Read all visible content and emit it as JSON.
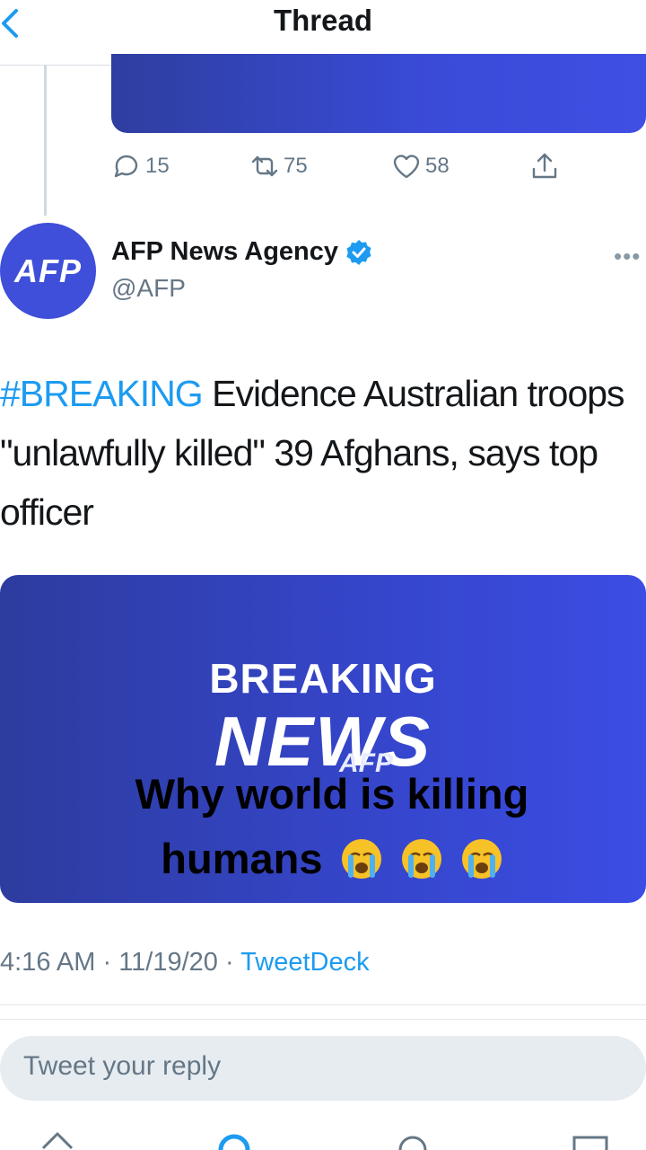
{
  "header": {
    "title": "Thread"
  },
  "prev_tweet": {
    "replies": "15",
    "retweets": "75",
    "likes": "58"
  },
  "tweet": {
    "author_name": "AFP News Agency",
    "handle": "@AFP",
    "avatar_text": "AFP",
    "hashtag": "#BREAKING",
    "body": " Evidence Australian troops \"unlawfully killed\" 39 Afghans, says top officer",
    "media": {
      "line1": "BREAKING",
      "line2": "NEWS",
      "brand": "AFP",
      "overlay_text": "Why world is killing humans"
    },
    "time": "4:16 AM",
    "date": "11/19/20",
    "source": "TweetDeck"
  },
  "reply": {
    "placeholder": "Tweet your reply"
  },
  "colors": {
    "accent": "#1d9bf0",
    "brand_blue": "#3f4fd9"
  }
}
